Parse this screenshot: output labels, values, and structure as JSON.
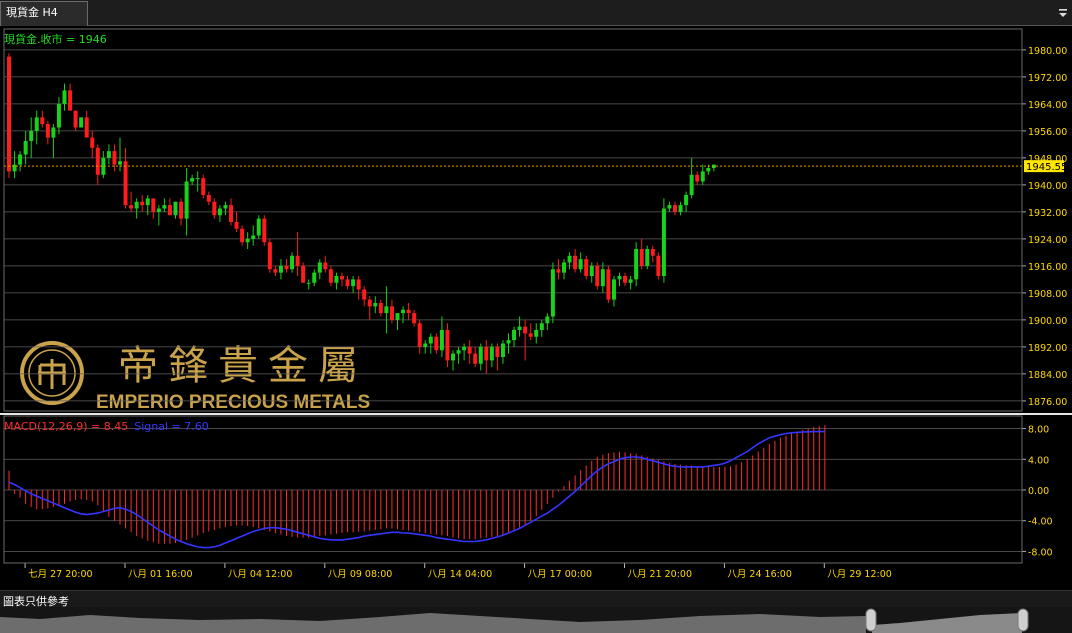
{
  "tab": {
    "title": "現貨金 H4"
  },
  "disclaimer": "圖表只供參考",
  "watermark": {
    "chinese": "帝鋒貴金屬",
    "english": "EMPERIO PRECIOUS METALS"
  },
  "colors": {
    "up": "#19d219",
    "down": "#ff1c1c",
    "grid": "#5f5f5f",
    "axis_text": "#ffd800",
    "label_green": "#22dd22",
    "macd_label": "#ff2b2b",
    "signal": "#3535ff",
    "current_price": "#e69900",
    "watermark_gold": "#c9a24a"
  },
  "chart_data": {
    "type": "candlestick",
    "instrument": "現貨金",
    "timeframe": "H4",
    "price_label": "現貨金.收市 = 1946",
    "current_price": 1945.55,
    "current_price_label": "1945.55",
    "ylim": [
      1873,
      1985
    ],
    "yticks": [
      1980,
      1972,
      1964,
      1956,
      1948,
      1940,
      1932,
      1924,
      1916,
      1908,
      1900,
      1892,
      1884,
      1876
    ],
    "ytick_labels": [
      "1980.00",
      "1972.00",
      "1964.00",
      "1956.00",
      "1948.00",
      "1940.00",
      "1932.00",
      "1924.00",
      "1916.00",
      "1908.00",
      "1900.00",
      "1892.00",
      "1884.00",
      "1876.00"
    ],
    "xtick_labels": [
      "七月 27 20:00",
      "八月 01 16:00",
      "八月 04 12:00",
      "八月 09 08:00",
      "八月 14 04:00",
      "八月 17 00:00",
      "八月 21 20:00",
      "八月 24 16:00",
      "八月 29 12:00"
    ],
    "xtick_candle_index": [
      2,
      20,
      38,
      56,
      74,
      92,
      110,
      128,
      146
    ],
    "candles": [
      [
        1978,
        1979,
        1942,
        1944
      ],
      [
        1944,
        1950,
        1942,
        1946
      ],
      [
        1946,
        1950,
        1944,
        1949
      ],
      [
        1949,
        1956,
        1946,
        1953
      ],
      [
        1953,
        1960,
        1948,
        1956
      ],
      [
        1956,
        1962,
        1952,
        1960
      ],
      [
        1960,
        1962,
        1957,
        1958
      ],
      [
        1958,
        1959,
        1952,
        1954
      ],
      [
        1954,
        1958,
        1948,
        1957
      ],
      [
        1957,
        1966,
        1955,
        1964
      ],
      [
        1964,
        1970,
        1962,
        1968
      ],
      [
        1968,
        1970,
        1962,
        1962
      ],
      [
        1962,
        1962,
        1956,
        1957
      ],
      [
        1957,
        1960,
        1958,
        1960
      ],
      [
        1960,
        1962,
        1954,
        1954
      ],
      [
        1954,
        1956,
        1948,
        1951
      ],
      [
        1951,
        1952,
        1940,
        1943
      ],
      [
        1943,
        1950,
        1942,
        1948
      ],
      [
        1948,
        1952,
        1946,
        1950
      ],
      [
        1950,
        1952,
        1944,
        1946
      ],
      [
        1946,
        1954,
        1944,
        1947
      ],
      [
        1947,
        1951,
        1933,
        1934
      ],
      [
        1934,
        1938,
        1932,
        1933
      ],
      [
        1933,
        1936,
        1930,
        1935
      ],
      [
        1935,
        1937,
        1932,
        1934
      ],
      [
        1934,
        1937,
        1931,
        1936
      ],
      [
        1936,
        1936,
        1930,
        1932
      ],
      [
        1932,
        1934,
        1928,
        1933
      ],
      [
        1933,
        1936,
        1932,
        1934
      ],
      [
        1934,
        1936,
        1931,
        1931
      ],
      [
        1931,
        1935,
        1930,
        1935
      ],
      [
        1935,
        1936,
        1928,
        1930
      ],
      [
        1930,
        1945,
        1925,
        1941
      ],
      [
        1941,
        1943,
        1940,
        1942
      ],
      [
        1942,
        1944,
        1938,
        1942
      ],
      [
        1942,
        1943,
        1936,
        1937
      ],
      [
        1937,
        1938,
        1934,
        1935
      ],
      [
        1935,
        1936,
        1930,
        1931
      ],
      [
        1931,
        1934,
        1929,
        1933
      ],
      [
        1933,
        1935,
        1931,
        1934
      ],
      [
        1934,
        1936,
        1928,
        1929
      ],
      [
        1929,
        1932,
        1926,
        1927
      ],
      [
        1927,
        1928,
        1922,
        1923
      ],
      [
        1923,
        1926,
        1921,
        1924
      ],
      [
        1924,
        1928,
        1922,
        1925
      ],
      [
        1925,
        1931,
        1924,
        1930
      ],
      [
        1930,
        1931,
        1922,
        1923
      ],
      [
        1923,
        1924,
        1914,
        1915
      ],
      [
        1915,
        1916,
        1913,
        1914
      ],
      [
        1914,
        1918,
        1912,
        1916
      ],
      [
        1916,
        1918,
        1914,
        1915
      ],
      [
        1915,
        1920,
        1914,
        1919
      ],
      [
        1919,
        1926,
        1913,
        1916
      ],
      [
        1916,
        1917,
        1911,
        1911
      ],
      [
        1911,
        1912,
        1909,
        1911
      ],
      [
        1911,
        1915,
        1910,
        1914
      ],
      [
        1914,
        1918,
        1912,
        1917
      ],
      [
        1917,
        1919,
        1914,
        1915
      ],
      [
        1915,
        1916,
        1910,
        1911
      ],
      [
        1911,
        1914,
        1909,
        1913
      ],
      [
        1913,
        1914,
        1910,
        1912
      ],
      [
        1912,
        1913,
        1909,
        1910
      ],
      [
        1910,
        1913,
        1908,
        1912
      ],
      [
        1912,
        1913,
        1906,
        1909
      ],
      [
        1909,
        1910,
        1904,
        1906
      ],
      [
        1906,
        1907,
        1900,
        1904
      ],
      [
        1904,
        1907,
        1902,
        1905
      ],
      [
        1905,
        1906,
        1901,
        1902
      ],
      [
        1902,
        1910,
        1896,
        1904
      ],
      [
        1904,
        1906,
        1899,
        1900
      ],
      [
        1900,
        1902,
        1897,
        1902
      ],
      [
        1902,
        1904,
        1899,
        1903
      ],
      [
        1903,
        1905,
        1900,
        1902
      ],
      [
        1902,
        1903,
        1898,
        1899
      ],
      [
        1899,
        1900,
        1890,
        1892
      ],
      [
        1892,
        1894,
        1890,
        1893
      ],
      [
        1893,
        1896,
        1890,
        1895
      ],
      [
        1895,
        1896,
        1890,
        1891
      ],
      [
        1891,
        1901,
        1889,
        1897
      ],
      [
        1897,
        1899,
        1886,
        1888
      ],
      [
        1888,
        1891,
        1885,
        1890
      ],
      [
        1890,
        1892,
        1887,
        1891
      ],
      [
        1891,
        1893,
        1888,
        1892
      ],
      [
        1892,
        1894,
        1887,
        1890
      ],
      [
        1890,
        1892,
        1886,
        1887
      ],
      [
        1887,
        1893,
        1885,
        1892
      ],
      [
        1892,
        1894,
        1884,
        1888
      ],
      [
        1888,
        1893,
        1886,
        1892
      ],
      [
        1892,
        1893,
        1885,
        1889
      ],
      [
        1889,
        1894,
        1887,
        1893
      ],
      [
        1893,
        1896,
        1890,
        1894
      ],
      [
        1894,
        1898,
        1892,
        1897
      ],
      [
        1897,
        1901,
        1895,
        1898
      ],
      [
        1898,
        1900,
        1888,
        1896
      ],
      [
        1896,
        1899,
        1894,
        1895
      ],
      [
        1895,
        1899,
        1893,
        1897
      ],
      [
        1897,
        1900,
        1895,
        1899
      ],
      [
        1899,
        1902,
        1897,
        1901
      ],
      [
        1901,
        1917,
        1899,
        1915
      ],
      [
        1915,
        1918,
        1912,
        1914
      ],
      [
        1914,
        1918,
        1912,
        1917
      ],
      [
        1917,
        1920,
        1915,
        1919
      ],
      [
        1919,
        1921,
        1914,
        1915
      ],
      [
        1915,
        1920,
        1914,
        1918
      ],
      [
        1918,
        1919,
        1912,
        1913
      ],
      [
        1913,
        1917,
        1911,
        1916
      ],
      [
        1916,
        1917,
        1909,
        1910
      ],
      [
        1910,
        1917,
        1908,
        1915
      ],
      [
        1915,
        1916,
        1905,
        1906
      ],
      [
        1906,
        1913,
        1904,
        1912
      ],
      [
        1912,
        1914,
        1910,
        1913
      ],
      [
        1913,
        1914,
        1910,
        1911
      ],
      [
        1911,
        1913,
        1909,
        1912
      ],
      [
        1912,
        1923,
        1910,
        1921
      ],
      [
        1921,
        1924,
        1915,
        1916
      ],
      [
        1916,
        1922,
        1915,
        1921
      ],
      [
        1921,
        1922,
        1917,
        1919
      ],
      [
        1919,
        1920,
        1912,
        1913
      ],
      [
        1913,
        1936,
        1911,
        1933
      ],
      [
        1933,
        1935,
        1932,
        1934
      ],
      [
        1934,
        1935,
        1931,
        1932
      ],
      [
        1932,
        1935,
        1931,
        1934
      ],
      [
        1934,
        1938,
        1932,
        1937
      ],
      [
        1937,
        1948,
        1936,
        1943
      ],
      [
        1943,
        1944,
        1940,
        1941
      ],
      [
        1941,
        1946,
        1940,
        1944
      ],
      [
        1944,
        1946,
        1943,
        1945
      ],
      [
        1945,
        1946,
        1944,
        1946
      ]
    ],
    "macd": {
      "label": "MACD(12,26,9) = 8.45",
      "signal_label": "Signal = 7.60",
      "value": 8.45,
      "signal": 7.6,
      "ylim": [
        -9.5,
        9.5
      ],
      "yticks": [
        8,
        4,
        0,
        -4,
        -8
      ],
      "ytick_labels": [
        "8.00",
        "4.00",
        "0.00",
        "-4.00",
        "-8.00"
      ],
      "histogram": [
        2.5,
        -0.5,
        -1.0,
        -1.8,
        -2.2,
        -2.5,
        -2.5,
        -2.4,
        -2.2,
        -2.0,
        -1.8,
        -1.5,
        -1.3,
        -1.2,
        -1.3,
        -1.5,
        -2.0,
        -2.8,
        -3.5,
        -4.0,
        -4.5,
        -5.0,
        -5.5,
        -6.0,
        -6.3,
        -6.6,
        -6.8,
        -7.0,
        -7.0,
        -7.0,
        -6.9,
        -6.8,
        -6.5,
        -6.2,
        -5.9,
        -5.6,
        -5.4,
        -5.2,
        -5.0,
        -4.8,
        -4.7,
        -4.6,
        -4.6,
        -4.7,
        -4.8,
        -5.0,
        -5.2,
        -5.4,
        -5.6,
        -5.8,
        -6.0,
        -6.1,
        -6.2,
        -6.2,
        -6.2,
        -6.1,
        -6.0,
        -5.9,
        -5.8,
        -5.7,
        -5.6,
        -5.5,
        -5.5,
        -5.4,
        -5.4,
        -5.3,
        -5.2,
        -5.1,
        -5.0,
        -5.0,
        -5.1,
        -5.2,
        -5.3,
        -5.4,
        -5.5,
        -5.6,
        -5.7,
        -5.8,
        -5.9,
        -6.0,
        -6.2,
        -6.3,
        -6.4,
        -6.4,
        -6.4,
        -6.3,
        -6.2,
        -6.1,
        -6.0,
        -5.8,
        -5.5,
        -5.2,
        -4.9,
        -4.5,
        -4.0,
        -3.4,
        -2.6,
        -1.8,
        -1.0,
        -0.2,
        0.5,
        1.2,
        1.9,
        2.6,
        3.2,
        3.8,
        4.3,
        4.6,
        4.8,
        4.9,
        5.0,
        4.9,
        4.8,
        4.7,
        4.5,
        4.3,
        4.1,
        3.9,
        3.7,
        3.5,
        3.4,
        3.3,
        3.2,
        3.2,
        3.1,
        3.1,
        3.1,
        3.0,
        3.0,
        3.0,
        3.1,
        3.3,
        3.6,
        4.0,
        4.5,
        5.0,
        5.5,
        6.0,
        6.4,
        6.8,
        7.1,
        7.4,
        7.6,
        7.8,
        8.0,
        8.2,
        8.3,
        8.45
      ],
      "signal_line": [
        1.0,
        0.7,
        0.3,
        -0.1,
        -0.5,
        -0.8,
        -1.1,
        -1.4,
        -1.7,
        -2.0,
        -2.3,
        -2.6,
        -2.9,
        -3.1,
        -3.2,
        -3.1,
        -3.0,
        -2.8,
        -2.6,
        -2.4,
        -2.3,
        -2.5,
        -2.8,
        -3.2,
        -3.7,
        -4.2,
        -4.7,
        -5.2,
        -5.6,
        -6.0,
        -6.4,
        -6.7,
        -7.0,
        -7.2,
        -7.4,
        -7.5,
        -7.5,
        -7.4,
        -7.2,
        -6.9,
        -6.6,
        -6.3,
        -6.0,
        -5.7,
        -5.4,
        -5.2,
        -5.0,
        -4.9,
        -4.9,
        -5.0,
        -5.1,
        -5.3,
        -5.5,
        -5.7,
        -5.9,
        -6.1,
        -6.3,
        -6.4,
        -6.5,
        -6.5,
        -6.5,
        -6.4,
        -6.3,
        -6.2,
        -6.0,
        -5.9,
        -5.8,
        -5.7,
        -5.6,
        -5.5,
        -5.5,
        -5.6,
        -5.6,
        -5.7,
        -5.8,
        -5.9,
        -6.0,
        -6.2,
        -6.3,
        -6.4,
        -6.5,
        -6.6,
        -6.7,
        -6.7,
        -6.7,
        -6.6,
        -6.5,
        -6.3,
        -6.1,
        -5.9,
        -5.6,
        -5.3,
        -5.0,
        -4.6,
        -4.2,
        -3.8,
        -3.4,
        -3.0,
        -2.5,
        -2.0,
        -1.4,
        -0.8,
        -0.2,
        0.5,
        1.2,
        1.9,
        2.5,
        3.0,
        3.4,
        3.7,
        4.0,
        4.2,
        4.3,
        4.3,
        4.2,
        4.0,
        3.8,
        3.6,
        3.4,
        3.2,
        3.1,
        3.0,
        3.0,
        3.0,
        3.0,
        3.0,
        3.1,
        3.2,
        3.3,
        3.5,
        3.8,
        4.2,
        4.6,
        5.0,
        5.5,
        6.0,
        6.4,
        6.8,
        7.0,
        7.2,
        7.35,
        7.45,
        7.5,
        7.55,
        7.58,
        7.6,
        7.6,
        7.6
      ]
    }
  }
}
